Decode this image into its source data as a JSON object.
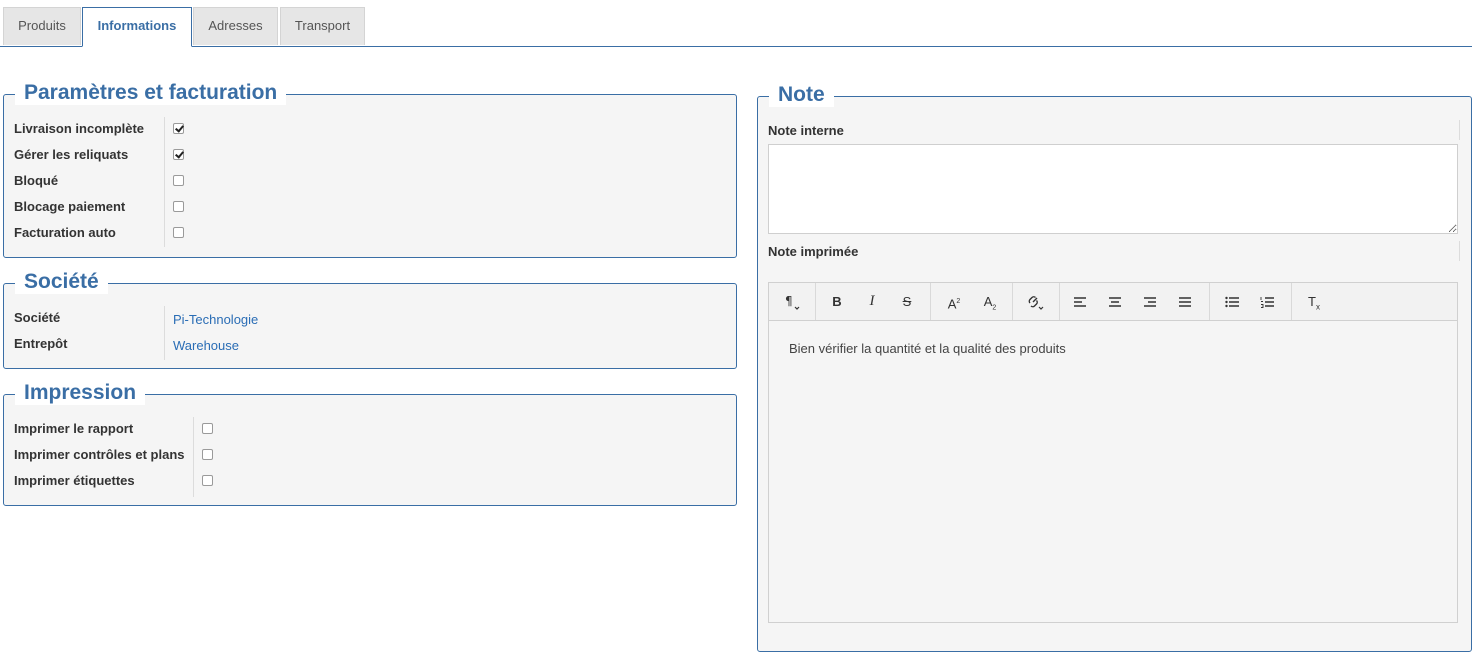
{
  "tabs": [
    {
      "label": "Produits"
    },
    {
      "label": "Informations"
    },
    {
      "label": "Adresses"
    },
    {
      "label": "Transport"
    }
  ],
  "parametres": {
    "title": "Paramètres et facturation",
    "items": [
      {
        "label": "Livraison incomplète",
        "checked": true
      },
      {
        "label": "Gérer les reliquats",
        "checked": true
      },
      {
        "label": "Bloqué",
        "checked": false
      },
      {
        "label": "Blocage paiement",
        "checked": false
      },
      {
        "label": "Facturation auto",
        "checked": false
      }
    ]
  },
  "societe": {
    "title": "Société",
    "items": [
      {
        "label": "Société",
        "value": "Pi-Technologie"
      },
      {
        "label": "Entrepôt",
        "value": "Warehouse"
      }
    ]
  },
  "impression": {
    "title": "Impression",
    "items": [
      {
        "label": "Imprimer le rapport",
        "checked": false
      },
      {
        "label": "Imprimer contrôles et plans",
        "checked": false
      },
      {
        "label": "Imprimer étiquettes",
        "checked": false
      }
    ]
  },
  "note": {
    "title": "Note",
    "internal_label": "Note interne",
    "internal_value": "",
    "printed_label": "Note imprimée",
    "printed_value": "Bien vérifier la quantité et la qualité des produits",
    "toolbar_icons": [
      "paragraph-icon",
      "bold-icon",
      "italic-icon",
      "strikethrough-icon",
      "superscript-icon",
      "subscript-icon",
      "link-icon",
      "align-left-icon",
      "align-center-icon",
      "align-right-icon",
      "align-justify-icon",
      "bullet-list-icon",
      "numbered-list-icon",
      "clear-format-icon"
    ]
  },
  "colors": {
    "accent": "#3a6ea5",
    "link": "#2a6db5",
    "panel_bg": "#f5f5f5"
  }
}
